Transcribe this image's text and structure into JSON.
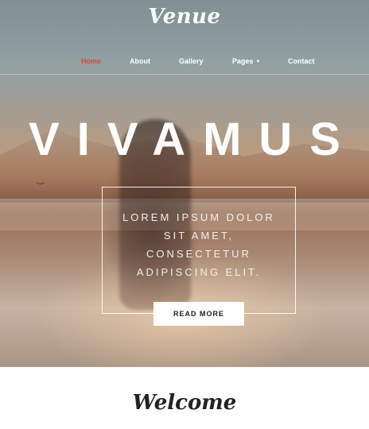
{
  "brand": {
    "name": "Venue"
  },
  "nav": {
    "items": [
      {
        "label": "Home",
        "active": true
      },
      {
        "label": "About"
      },
      {
        "label": "Gallery"
      },
      {
        "label": "Pages",
        "has_dropdown": true
      },
      {
        "label": "Contact"
      }
    ]
  },
  "hero": {
    "headline": "VIVAMUS",
    "tagline_lines": [
      "LOREM IPSUM DOLOR",
      "SIT AMET,",
      "CONSECTETUR",
      "ADIPISCING ELIT."
    ],
    "cta_label": "READ MORE"
  },
  "welcome": {
    "title": "Welcome"
  },
  "colors": {
    "accent": "#e2463a",
    "text_light": "#ffffff",
    "text_dark": "#222222"
  }
}
